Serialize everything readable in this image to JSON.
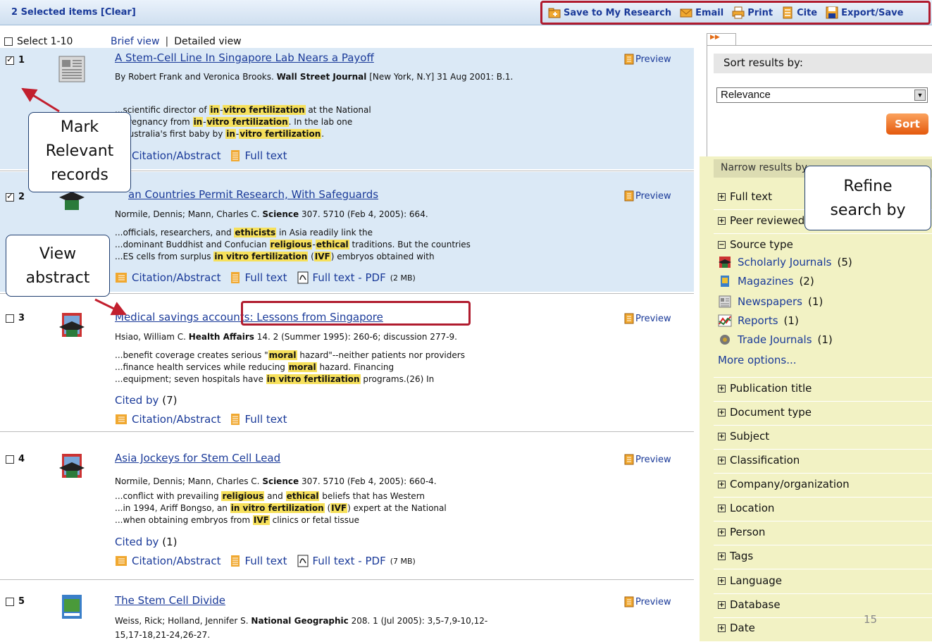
{
  "topbar": {
    "selected_text": "2 Selected items",
    "clear_label": "[Clear]"
  },
  "toolbar": {
    "save": "Save to My Research",
    "email": "Email",
    "print": "Print",
    "cite": "Cite",
    "export": "Export/Save"
  },
  "selectbar": {
    "select_label": "Select 1-10",
    "brief_view": "Brief view",
    "separator": "|",
    "detailed_view": "Detailed view"
  },
  "results": [
    {
      "num": "1",
      "title": "A Stem-Cell Line In Singapore Lab Nears a Payoff",
      "authors": "By Robert Frank and Veronica Brooks.",
      "source": "Wall Street Journal",
      "details": "[New York, N.Y] 31 Aug 2001: B.1.",
      "snip1_pre": "...scientific director of ",
      "snip1_after": " at the National",
      "snip2_pre": "...pregnancy from ",
      "snip2_after": ". In the lab one",
      "snip3_pre": "...Australia's first baby by ",
      "snip3_after": ".",
      "hl_in": "in",
      "hl_dash": "-",
      "hl_vitro": "vitro fertilization",
      "citation": "Citation/Abstract",
      "fulltext": "Full text"
    },
    {
      "num": "2",
      "title_visible": "an Countries Permit Research, With Safeguards",
      "authors": "Normile, Dennis; Mann, Charles C.",
      "source": "Science",
      "details": "307. 5710  (Feb 4, 2005): 664.",
      "snip1_pre": "...officials, researchers, and ",
      "snip1_hl": "ethicists",
      "snip1_after": " in Asia readily link the",
      "snip2_pre": "...dominant Buddhist and Confucian ",
      "snip2_hl1": "religious",
      "snip2_dash": "-",
      "snip2_hl2": "ethical",
      "snip2_after": " traditions. But the countries",
      "snip3_pre": "...ES cells from surplus ",
      "snip3_hl": "in vitro fertilization",
      "snip3_mid": " (",
      "snip3_hl2": "IVF",
      "snip3_after": ") embryos obtained with",
      "citation": "Citation/Abstract",
      "fulltext": "Full text",
      "pdf": "Full text - PDF",
      "pdf_size": "(2 MB)"
    },
    {
      "num": "3",
      "title": "Medical savings accounts: Lessons from Singapore",
      "authors": "Hsiao, William C.",
      "source": "Health Affairs",
      "details": "14. 2  (Summer 1995): 260-6; discussion 277-9.",
      "snip1_pre": "...benefit coverage creates serious \"",
      "snip1_hl": "moral",
      "snip1_after": " hazard\"--neither patients nor providers",
      "snip2_pre": "...finance health services while reducing ",
      "snip2_hl": "moral",
      "snip2_after": " hazard. Financing",
      "snip3_pre": "...equipment; seven hospitals have ",
      "snip3_hl": "in vitro fertilization",
      "snip3_after": " programs.(26) In",
      "cited_label": "Cited by",
      "cited_count": "(7)",
      "citation": "Citation/Abstract",
      "fulltext": "Full text"
    },
    {
      "num": "4",
      "title": "Asia Jockeys for Stem Cell Lead",
      "authors": "Normile, Dennis; Mann, Charles C.",
      "source": "Science",
      "details": "307. 5710  (Feb 4, 2005): 660-4.",
      "snip1_pre": "...conflict with prevailing ",
      "snip1_hl1": "religious",
      "snip1_mid": " and ",
      "snip1_hl2": "ethical",
      "snip1_after": " beliefs that has Western",
      "snip2_pre": "...in 1994, Ariff Bongso, an ",
      "snip2_hl": "in vitro fertilization",
      "snip2_mid": " (",
      "snip2_hl2": "IVF",
      "snip2_after": ") expert at the National",
      "snip3_pre": "...when obtaining embryos from ",
      "snip3_hl": "IVF",
      "snip3_after": " clinics or fetal tissue",
      "cited_label": "Cited by",
      "cited_count": "(1)",
      "citation": "Citation/Abstract",
      "fulltext": "Full text",
      "pdf": "Full text - PDF",
      "pdf_size": "(7 MB)"
    },
    {
      "num": "5",
      "title": "The Stem Cell Divide",
      "authors": "Weiss, Rick; Holland, Jennifer S.",
      "source": "National Geographic",
      "details": "208. 1  (Jul 2005): 3,5-7,9-10,12-",
      "details2": "15,17-18,21-24,26-27."
    }
  ],
  "preview_label": "Preview",
  "callouts": {
    "mark1": "Mark",
    "mark2": "Relevant",
    "mark3": "records",
    "view1": "View",
    "view2": "abstract",
    "refine1": "Refine",
    "refine2": "search by"
  },
  "sidebar": {
    "tab_glyph": "▶▶",
    "sort_header": "Sort results by:",
    "sort_value": "Relevance",
    "sort_button": "Sort",
    "narrow_header": "Narrow results by",
    "facets_top": [
      "Full text",
      "Peer reviewed"
    ],
    "source_type": "Source type",
    "sources": [
      {
        "label": "Scholarly Journals",
        "count": "(5)"
      },
      {
        "label": "Magazines",
        "count": "(2)"
      },
      {
        "label": "Newspapers",
        "count": "(1)"
      },
      {
        "label": "Reports",
        "count": "(1)"
      },
      {
        "label": "Trade Journals",
        "count": "(1)"
      }
    ],
    "more_options": "More options...",
    "facets": [
      "Publication title",
      "Document type",
      "Subject",
      "Classification",
      "Company/organization",
      "Location",
      "Person",
      "Tags",
      "Language",
      "Database",
      "Date"
    ]
  },
  "page_number": "15",
  "colors": {
    "accent_red": "#b01b2e",
    "link_blue": "#1a3a99",
    "highlight": "#f6e05b",
    "sort_orange": "#e4590d",
    "sidebar_yellow": "#f2f2c4"
  }
}
